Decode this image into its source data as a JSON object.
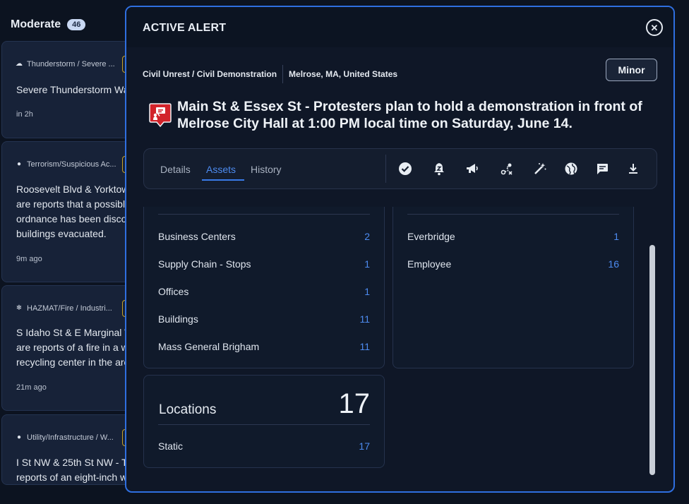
{
  "background": {
    "header": {
      "title": "Moderate",
      "count": "46"
    },
    "cards": [
      {
        "category": "Thunderstorm / Severe ...",
        "icon": "storm-icon",
        "description": "Severe Thunderstorm Wa",
        "time": "in 2h"
      },
      {
        "category": "Terrorism/Suspicious Ac...",
        "icon": "suspect-icon",
        "description": "Roosevelt Blvd & Yorktow\nare reports that a possibl\nordnance has been disco\nbuildings evacuated.",
        "time": "9m ago"
      },
      {
        "category": "HAZMAT/Fire / Industri...",
        "icon": "flame-icon",
        "description": "S Idaho St & E Marginal W\nare reports of a fire in a w\nrecycling center in the are",
        "time": "21m ago"
      },
      {
        "category": "Utility/Infrastructure / W...",
        "icon": "bulb-icon",
        "description": "I St NW & 25th St NW - Th\nreports of an eight-inch w",
        "time": ""
      }
    ]
  },
  "modal": {
    "title": "ACTIVE ALERT",
    "close_icon": "close-icon",
    "category": "Civil Unrest / Civil Demonstration",
    "location": "Melrose, MA, United States",
    "severity": "Minor",
    "headline": "Main St & Essex St - Protesters plan to hold a demonstration in front of Melrose City Hall at 1:00 PM local time on Saturday, June 14.",
    "tabs": [
      {
        "label": "Details",
        "active": false
      },
      {
        "label": "Assets",
        "active": true
      },
      {
        "label": "History",
        "active": false
      }
    ],
    "tools": [
      "check-circle-icon",
      "snooze-bell-icon",
      "megaphone-icon",
      "route-icon",
      "magic-wand-icon",
      "globe-icon",
      "comment-icon",
      "download-icon"
    ],
    "assets_left": [
      {
        "label": "Business Centers",
        "count": "2"
      },
      {
        "label": "Supply Chain - Stops",
        "count": "1"
      },
      {
        "label": "Offices",
        "count": "1"
      },
      {
        "label": "Buildings",
        "count": "11"
      },
      {
        "label": "Mass General Brigham",
        "count": "11"
      }
    ],
    "assets_right": [
      {
        "label": "Everbridge",
        "count": "1"
      },
      {
        "label": "Employee",
        "count": "16"
      }
    ],
    "locations": {
      "title": "Locations",
      "total": "17",
      "rows": [
        {
          "label": "Static",
          "count": "17"
        }
      ]
    },
    "colors": {
      "accent": "#2f6fe0",
      "link": "#4d8bf0",
      "alert_red": "#d2232a"
    }
  }
}
